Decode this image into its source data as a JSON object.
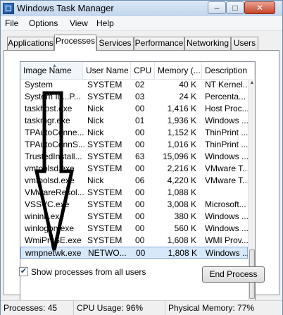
{
  "window": {
    "title": "Windows Task Manager",
    "minimize_glyph": "–",
    "maximize_glyph": "□",
    "close_glyph": "✕"
  },
  "menu": [
    "File",
    "Options",
    "View",
    "Help"
  ],
  "tabs": [
    "Applications",
    "Processes",
    "Services",
    "Performance",
    "Networking",
    "Users"
  ],
  "active_tab": "Processes",
  "columns": [
    "Image Name",
    "User Name",
    "CPU",
    "Memory (...",
    "Description"
  ],
  "sort_glyph": "▲",
  "rows": [
    {
      "name": "System",
      "user": "SYSTEM",
      "cpu": "02",
      "mem": "40 K",
      "desc": "NT Kernel..."
    },
    {
      "name": "System Id...P...",
      "user": "SYSTEM",
      "cpu": "03",
      "mem": "24 K",
      "desc": "Percenta..."
    },
    {
      "name": "taskhost.exe",
      "user": "Nick",
      "cpu": "00",
      "mem": "1,416 K",
      "desc": "Host Proc..."
    },
    {
      "name": "taskmgr.exe",
      "user": "Nick",
      "cpu": "01",
      "mem": "1,936 K",
      "desc": "Windows ..."
    },
    {
      "name": "TPAutoConne...",
      "user": "Nick",
      "cpu": "00",
      "mem": "1,152 K",
      "desc": "ThinPrint ..."
    },
    {
      "name": "TPAutoConnS...",
      "user": "SYSTEM",
      "cpu": "00",
      "mem": "1,016 K",
      "desc": "ThinPrint ..."
    },
    {
      "name": "TrustedInstall...",
      "user": "SYSTEM",
      "cpu": "63",
      "mem": "15,096 K",
      "desc": "Windows ..."
    },
    {
      "name": "vmtoolsd.exe",
      "user": "SYSTEM",
      "cpu": "00",
      "mem": "2,216 K",
      "desc": "VMware T..."
    },
    {
      "name": "vmtoolsd.exe",
      "user": "Nick",
      "cpu": "06",
      "mem": "4,220 K",
      "desc": "VMware T..."
    },
    {
      "name": "VMwareResol...",
      "user": "SYSTEM",
      "cpu": "00",
      "mem": "1,088 K",
      "desc": ""
    },
    {
      "name": "VSSVC.exe",
      "user": "SYSTEM",
      "cpu": "00",
      "mem": "3,008 K",
      "desc": "Microsoft..."
    },
    {
      "name": "wininit.exe",
      "user": "SYSTEM",
      "cpu": "00",
      "mem": "380 K",
      "desc": "Windows ..."
    },
    {
      "name": "winlogon.exe",
      "user": "SYSTEM",
      "cpu": "00",
      "mem": "560 K",
      "desc": "Windows ..."
    },
    {
      "name": "WmiPrvSE.exe",
      "user": "SYSTEM",
      "cpu": "00",
      "mem": "1,608 K",
      "desc": "WMI Prov..."
    },
    {
      "name": "wmpnetwk.exe",
      "user": "NETWO...",
      "cpu": "00",
      "mem": "1,808 K",
      "desc": "Windows ..."
    }
  ],
  "selected_row": 14,
  "show_all_label": "Show processes from all users",
  "show_all_checked": true,
  "check_glyph": "✔",
  "end_process_label": "End Process",
  "status": {
    "processes": "Processes: 45",
    "cpu": "CPU Usage: 96%",
    "memory": "Physical Memory: 77%"
  },
  "scroll_glyphs": {
    "up": "▲",
    "down": "▼"
  }
}
